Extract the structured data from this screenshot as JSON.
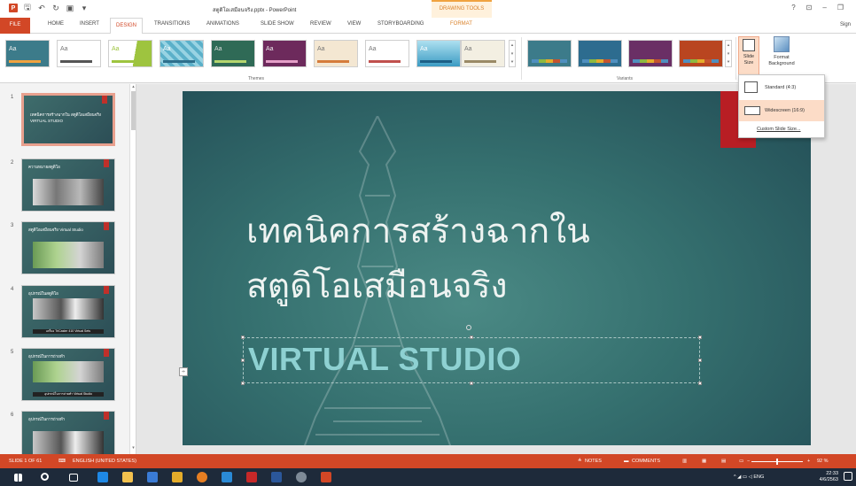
{
  "app": {
    "doc_title": "สตูดิโอเสมือนจริง.pptx - PowerPoint",
    "context_tab_group": "DRAWING TOOLS",
    "help": "?",
    "signin": "Sign"
  },
  "tabs": [
    {
      "label": "FILE"
    },
    {
      "label": "HOME"
    },
    {
      "label": "INSERT"
    },
    {
      "label": "DESIGN"
    },
    {
      "label": "TRANSITIONS"
    },
    {
      "label": "ANIMATIONS"
    },
    {
      "label": "SLIDE SHOW"
    },
    {
      "label": "REVIEW"
    },
    {
      "label": "VIEW"
    },
    {
      "label": "STORYBOARDING"
    },
    {
      "label": "FORMAT"
    }
  ],
  "ribbon": {
    "themes_label": "Themes",
    "variants_label": "Variants",
    "theme_glyph": "Aa",
    "slide_size_label": "Slide Size",
    "format_background_label": "Format Background"
  },
  "slide_size_menu": {
    "standard": "Standard (4:3)",
    "widescreen": "Widescreen (16:9)",
    "custom": "Custom Slide Size..."
  },
  "slides": [
    {
      "num": "1",
      "text": "เทคนิคการสร้างฉากใน สตูดิโอเสมือนจริง VIRTUAL STUDIO"
    },
    {
      "num": "2",
      "text": "ความหมายสตูดิโอ"
    },
    {
      "num": "3",
      "text": "สตูดิโอเสมือนจริง Virtual Studio"
    },
    {
      "num": "4",
      "text": "อุปกรณ์ในสตูดิโอ",
      "caption": "เครื่อง TriCaster 410 Virtual Sets"
    },
    {
      "num": "5",
      "text": "อุปกรณ์ในการถ่ายทำ",
      "caption": "อุปกรณ์ในการถ่ายทำ Virtual Studio"
    },
    {
      "num": "6",
      "text": "อุปกรณ์ในการถ่ายทำ"
    }
  ],
  "slide": {
    "title_line1": "เทคนิคการสร้างฉากใน",
    "title_line2": "สตูดิโอเสมือนจริง",
    "subtitle": "VIRTUAL STUDIO"
  },
  "status": {
    "slide_count": "SLIDE 1 OF 61",
    "language": "ENGLISH (UNITED STATES)",
    "notes": "NOTES",
    "comments": "COMMENTS",
    "zoom": "92 %"
  },
  "taskbar": {
    "lang": "ENG",
    "time": "22:33",
    "date": "4/6/2563"
  }
}
